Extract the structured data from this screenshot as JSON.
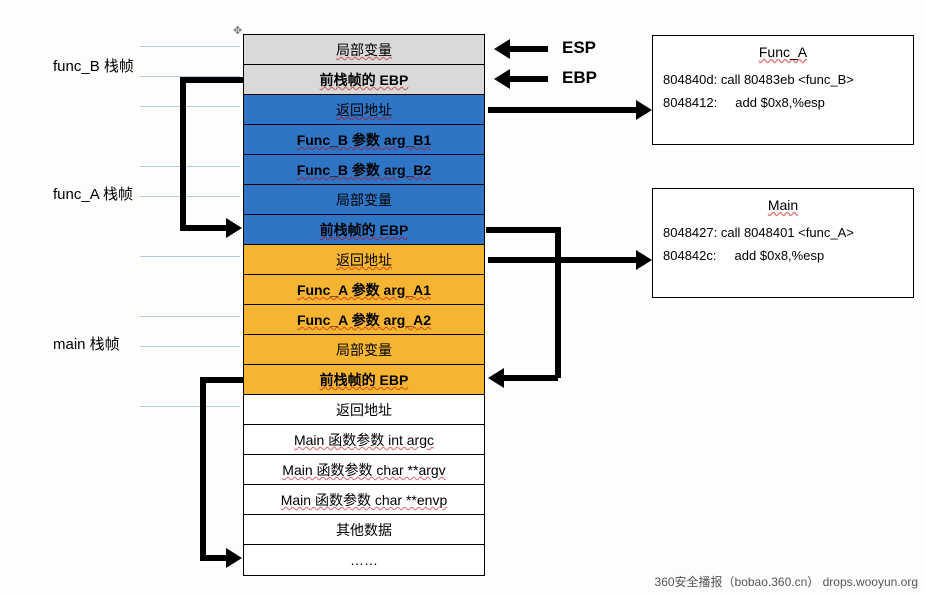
{
  "stack": {
    "rows": [
      {
        "text": "局部变量",
        "cls": "gray"
      },
      {
        "text": "前栈帧的 EBP",
        "cls": "gray bold"
      },
      {
        "text": "返回地址",
        "cls": "blue"
      },
      {
        "text": "Func_B 参数 arg_B1",
        "cls": "blue bold"
      },
      {
        "text": "Func_B 参数 arg_B2",
        "cls": "blue bold"
      },
      {
        "text": "局部变量",
        "cls": "blue"
      },
      {
        "text": "前栈帧的 EBP",
        "cls": "blue bold"
      },
      {
        "text": "返回地址",
        "cls": "orange"
      },
      {
        "text": "Func_A 参数 arg_A1",
        "cls": "orange bold"
      },
      {
        "text": "Func_A 参数 arg_A2",
        "cls": "orange bold"
      },
      {
        "text": "局部变量",
        "cls": "orange"
      },
      {
        "text": "前栈帧的 EBP",
        "cls": "orange bold"
      },
      {
        "text": "返回地址",
        "cls": "white"
      },
      {
        "text": "Main 函数参数 int argc",
        "cls": "white"
      },
      {
        "text": "Main 函数参数 char **argv",
        "cls": "white"
      },
      {
        "text": "Main 函数参数 char **envp",
        "cls": "white"
      },
      {
        "text": "其他数据",
        "cls": "white"
      },
      {
        "text": "……",
        "cls": "white"
      }
    ]
  },
  "frame_labels": {
    "b": "func_B 栈帧",
    "a": "func_A 栈帧",
    "main": "main 栈帧"
  },
  "pointers": {
    "esp": "ESP",
    "ebp": "EBP"
  },
  "code_box_a": {
    "title": "Func_A",
    "l1": "804840d: call 80483eb <func_B>",
    "l2": "8048412:     add $0x8,%esp"
  },
  "code_box_main": {
    "title": "Main",
    "l1": "8048427: call 8048401 <func_A>",
    "l2": "804842c:     add $0x8,%esp"
  },
  "watermark": "360安全播报（bobao.360.cn）  drops.wooyun.org"
}
